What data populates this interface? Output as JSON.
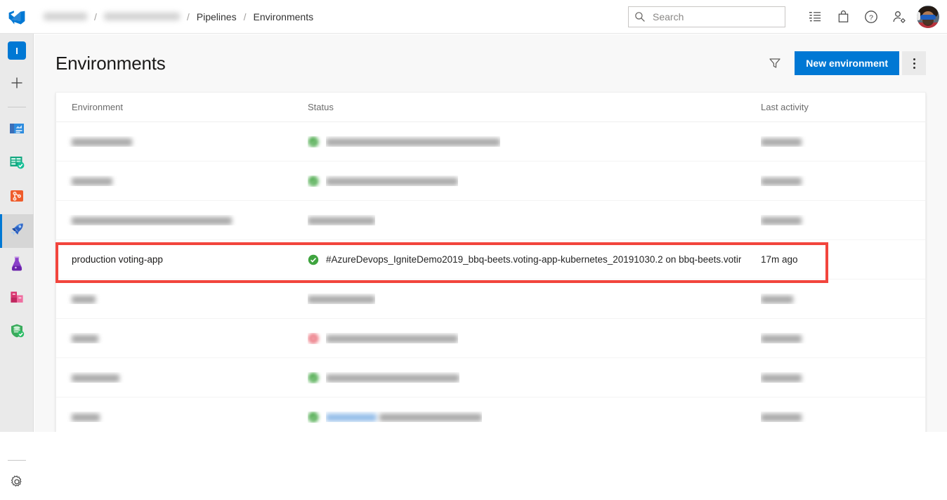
{
  "topbar": {
    "logo_icon": "azure-devops-logo-icon",
    "breadcrumb": [
      {
        "label": "",
        "redacted": true
      },
      {
        "label": "",
        "redacted": true
      },
      {
        "label": "Pipelines",
        "redacted": false
      },
      {
        "label": "Environments",
        "redacted": false
      }
    ],
    "separator": "/",
    "search": {
      "placeholder": "Search",
      "value": "",
      "icon": "search-icon"
    },
    "icons": [
      {
        "name": "task-list-icon"
      },
      {
        "name": "marketplace-bag-icon"
      },
      {
        "name": "help-question-icon"
      },
      {
        "name": "user-settings-icon"
      }
    ],
    "avatar": {
      "name": "user-avatar",
      "alt": "User profile photo"
    }
  },
  "rail": {
    "project_initial": "I",
    "items": [
      {
        "name": "project-avatar",
        "label": "I",
        "selected": false
      },
      {
        "name": "create-new-icon",
        "label": "",
        "selected": false
      },
      {
        "name": "overview-icon",
        "label": "Overview",
        "selected": false
      },
      {
        "name": "boards-icon",
        "label": "Boards",
        "selected": false
      },
      {
        "name": "repos-icon",
        "label": "Repos",
        "selected": false
      },
      {
        "name": "pipelines-icon",
        "label": "Pipelines",
        "selected": true
      },
      {
        "name": "test-plans-icon",
        "label": "Test Plans",
        "selected": false
      },
      {
        "name": "artifacts-icon",
        "label": "Artifacts",
        "selected": false
      },
      {
        "name": "security-shield-icon",
        "label": "Security",
        "selected": false
      },
      {
        "name": "project-settings-gear-icon",
        "label": "Project settings",
        "selected": false
      }
    ]
  },
  "page": {
    "title": "Environments",
    "filter_icon": "filter-funnel-icon",
    "new_environment_label": "New environment",
    "more_actions_icon": "more-options-icon",
    "accent_color": "#0078d4",
    "highlight_color": "#f2453d",
    "status_success_color": "#107c10",
    "status_failed_color": "#e81123"
  },
  "table": {
    "columns": [
      "Environment",
      "Status",
      "Last activity"
    ],
    "rows": [
      {
        "environment": "",
        "status_icon": "success-circle-icon",
        "status_color": "#3fa43f",
        "status_text": "",
        "last_activity": "Yesterday",
        "redacted": true,
        "highlighted": false,
        "env_bar_width": 86,
        "status_bar_width": 248,
        "activity_bar_width": 58
      },
      {
        "environment": "",
        "status_icon": "success-circle-icon",
        "status_color": "#3fa43f",
        "status_text": "",
        "last_activity": "Yesterday",
        "redacted": true,
        "highlighted": false,
        "env_bar_width": 58,
        "status_bar_width": 188,
        "activity_bar_width": 58
      },
      {
        "environment": "",
        "status_icon": "none",
        "status_color": "",
        "status_text": "Never deployed",
        "last_activity": "Yesterday",
        "redacted": true,
        "highlighted": false,
        "env_bar_width": 228,
        "status_bar_width": 96,
        "activity_bar_width": 58
      },
      {
        "environment": "production voting-app",
        "status_icon": "success-circle-icon",
        "status_color": "#3fa43f",
        "status_text": "#AzureDevops_IgniteDemo2019_bbq-beets.voting-app-kubernetes_20191030.2 on bbq-beets.votir",
        "last_activity": "17m ago",
        "redacted": false,
        "highlighted": true,
        "env_bar_width": 0,
        "status_bar_width": 0,
        "activity_bar_width": 0
      },
      {
        "environment": "",
        "status_icon": "none",
        "status_color": "",
        "status_text": "Never deployed",
        "last_activity": "25m ago",
        "redacted": true,
        "highlighted": false,
        "env_bar_width": 34,
        "status_bar_width": 96,
        "activity_bar_width": 46
      },
      {
        "environment": "",
        "status_icon": "failed-circle-icon",
        "status_color": "#e8616d",
        "status_text": "",
        "last_activity": "Yesterday",
        "redacted": true,
        "highlighted": false,
        "env_bar_width": 38,
        "status_bar_width": 188,
        "activity_bar_width": 58
      },
      {
        "environment": "",
        "status_icon": "success-circle-icon",
        "status_color": "#3fa43f",
        "status_text": "",
        "last_activity": "Yesterday",
        "redacted": true,
        "highlighted": false,
        "env_bar_width": 68,
        "status_bar_width": 190,
        "activity_bar_width": 58
      },
      {
        "environment": "",
        "status_icon": "success-circle-icon",
        "status_color": "#3fa43f",
        "status_text": "",
        "last_activity": "Yesterday",
        "redacted": true,
        "highlighted": false,
        "env_bar_width": 40,
        "status_bar_width": 218,
        "activity_bar_width": 58,
        "status_link_width": 72
      }
    ]
  }
}
